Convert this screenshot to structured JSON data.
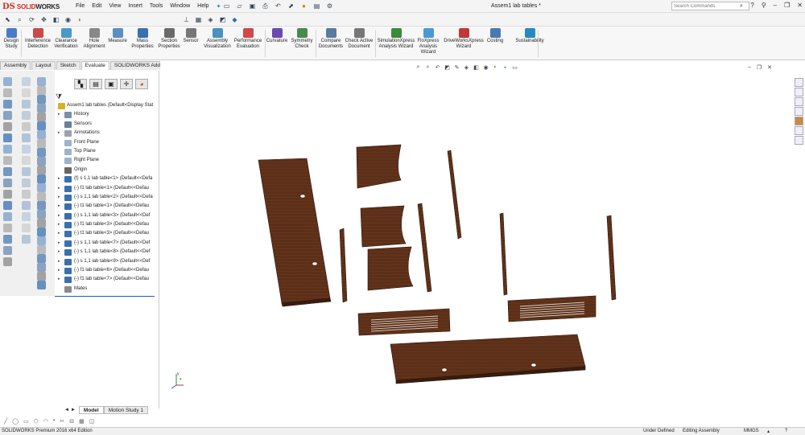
{
  "app": {
    "logo_ds": "DS",
    "logo_solid": "SOLID",
    "logo_works": "WORKS",
    "doc_title": "Assem1 lab tables *",
    "search_placeholder": "Search Commands",
    "accent": "#d52b1e"
  },
  "menu": [
    "File",
    "Edit",
    "View",
    "Insert",
    "Tools",
    "Window",
    "Help"
  ],
  "ribbon": [
    {
      "label": "Design\nStudy",
      "icon": "design-study-icon",
      "color": "#4a7bc8"
    },
    {
      "label": "Interference\nDetection",
      "icon": "interference-icon",
      "color": "#c84a4a"
    },
    {
      "label": "Clearance\nVerification",
      "icon": "clearance-icon",
      "color": "#4a9ac8"
    },
    {
      "label": "Hole\nAlignment",
      "icon": "hole-alignment-icon",
      "color": "#888888"
    },
    {
      "label": "Measure",
      "icon": "measure-icon",
      "color": "#5a8fc0"
    },
    {
      "label": "Mass\nProperties",
      "icon": "mass-properties-icon",
      "color": "#3a70b0"
    },
    {
      "label": "Section\nProperties",
      "icon": "section-properties-icon",
      "color": "#6a6a6a"
    },
    {
      "label": "Sensor",
      "icon": "sensor-icon",
      "color": "#777777"
    },
    {
      "label": "Assembly\nVisualization",
      "icon": "assembly-visualization-icon",
      "color": "#4a90c0"
    },
    {
      "label": "Performance\nEvaluation",
      "icon": "performance-icon",
      "color": "#d04848"
    },
    {
      "label": "Curvature",
      "icon": "curvature-icon",
      "color": "#6a4ab0"
    },
    {
      "label": "Symmetry\nCheck",
      "icon": "symmetry-icon",
      "color": "#4a8a4a"
    },
    {
      "label": "Compare\nDocuments",
      "icon": "compare-icon",
      "color": "#5a7aa0"
    },
    {
      "label": "Check Active\nDocument",
      "icon": "check-document-icon",
      "color": "#777777"
    },
    {
      "label": "SimulationXpress\nAnalysis Wizard",
      "icon": "simulationxpress-icon",
      "color": "#3a8a3a"
    },
    {
      "label": "FloXpress\nAnalysis\nWizard",
      "icon": "floxpress-icon",
      "color": "#4a9ad0"
    },
    {
      "label": "DriveWorksXpress\nWizard",
      "icon": "driveworks-icon",
      "color": "#c03838"
    },
    {
      "label": "Costing",
      "icon": "costing-icon",
      "color": "#4a7ab0"
    },
    {
      "label": "Sustainability",
      "icon": "sustainability-icon",
      "color": "#2a8ac0"
    }
  ],
  "tabs": [
    {
      "label": "Assembly",
      "active": false
    },
    {
      "label": "Layout",
      "active": false
    },
    {
      "label": "Sketch",
      "active": false
    },
    {
      "label": "Evaluate",
      "active": true
    },
    {
      "label": "SOLIDWORKS Add-Ins",
      "active": false
    }
  ],
  "tree": {
    "root": "Assem1 lab tables  (Default<Display Stat",
    "items": [
      {
        "label": "History",
        "icon": "history-icon",
        "expandable": true,
        "color": "#7a8fa8"
      },
      {
        "label": "Sensors",
        "icon": "sensors-icon",
        "expandable": false,
        "color": "#6a7f9a"
      },
      {
        "label": "Annotations",
        "icon": "annotations-icon",
        "expandable": true,
        "color": "#9aa2aa"
      },
      {
        "label": "Front Plane",
        "icon": "plane-icon",
        "expandable": false,
        "color": "#9fb3c8"
      },
      {
        "label": "Top Plane",
        "icon": "plane-icon",
        "expandable": false,
        "color": "#9fb3c8"
      },
      {
        "label": "Right Plane",
        "icon": "plane-icon",
        "expandable": false,
        "color": "#9fb3c8"
      },
      {
        "label": "Origin",
        "icon": "origin-icon",
        "expandable": false,
        "color": "#666666"
      },
      {
        "label": "(f) s 1,1 lab table<1> (Default<<Defa",
        "icon": "part-icon",
        "expandable": true,
        "color": "#3a6fb0"
      },
      {
        "label": "(-) f1 lab table<1> (Default<<Defau",
        "icon": "part-icon",
        "expandable": true,
        "color": "#3a6fb0"
      },
      {
        "label": "(-) s 1,1 lab table<2> (Default<<Defa",
        "icon": "part-icon",
        "expandable": true,
        "color": "#3a6fb0"
      },
      {
        "label": "(-) t1 lab table<1> (Default<<Defau",
        "icon": "part-icon",
        "expandable": true,
        "color": "#3a6fb0"
      },
      {
        "label": "(-) s 1,1 lab table<3> (Default<<Def",
        "icon": "part-icon",
        "expandable": true,
        "color": "#3a6fb0"
      },
      {
        "label": "(-) f1 lab table<3> (Default<<Defau",
        "icon": "part-icon",
        "expandable": true,
        "color": "#3a6fb0"
      },
      {
        "label": "(-) t1 lab table<3> (Default<<Defau",
        "icon": "part-icon",
        "expandable": true,
        "color": "#3a6fb0"
      },
      {
        "label": "(-) s 1,1 lab table<7> (Default<<Def",
        "icon": "part-icon",
        "expandable": true,
        "color": "#3a6fb0"
      },
      {
        "label": "(-) s 1,1 lab table<8> (Default<<Def",
        "icon": "part-icon",
        "expandable": true,
        "color": "#3a6fb0"
      },
      {
        "label": "(-) s 1,1 lab table<9> (Default<<Def",
        "icon": "part-icon",
        "expandable": true,
        "color": "#3a6fb0"
      },
      {
        "label": "(-) f1 lab table<6> (Default<<Defau",
        "icon": "part-icon",
        "expandable": true,
        "color": "#3a6fb0"
      },
      {
        "label": "(-) f1 lab table<7> (Default<<Defau",
        "icon": "part-icon",
        "expandable": true,
        "color": "#3a6fb0"
      },
      {
        "label": "Mates",
        "icon": "mates-icon",
        "expandable": false,
        "color": "#8a8a8a"
      }
    ]
  },
  "bottom_tabs": [
    {
      "label": "Model",
      "active": true
    },
    {
      "label": "Motion Study 1",
      "active": false
    }
  ],
  "status": {
    "edition": "SOLIDWORKS Premium 2016 x64 Edition",
    "state": "Under Defined",
    "mode": "Editing Assembly",
    "units": "MMGS"
  },
  "wood_color": "#5e3019"
}
